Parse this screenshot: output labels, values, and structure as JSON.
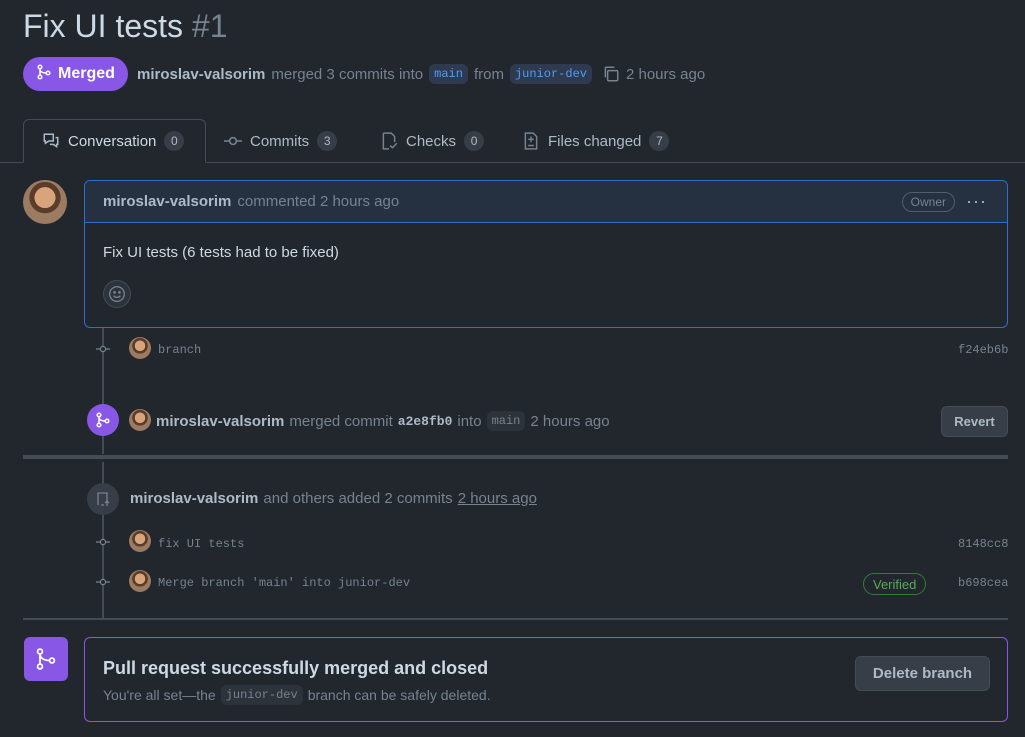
{
  "pr": {
    "title": "Fix UI tests",
    "number": "#1",
    "status": "Merged",
    "author": "miroslav-valsorim",
    "merged_text": "merged 3 commits into",
    "base_branch": "main",
    "from_text": "from",
    "head_branch": "junior-dev",
    "time": "2 hours ago"
  },
  "tabs": [
    {
      "label": "Conversation",
      "count": "0",
      "icon": "comment-discussion-icon"
    },
    {
      "label": "Commits",
      "count": "3",
      "icon": "git-commit-icon"
    },
    {
      "label": "Checks",
      "count": "0",
      "icon": "checklist-icon"
    },
    {
      "label": "Files changed",
      "count": "7",
      "icon": "file-diff-icon"
    }
  ],
  "comment": {
    "author": "miroslav-valsorim",
    "action": "commented 2 hours ago",
    "badge": "Owner",
    "more": "···",
    "body": "Fix UI tests (6 tests had to be fixed)"
  },
  "timeline": {
    "commit1": {
      "message": "branch",
      "sha": "f24eb6b"
    },
    "merge_event": {
      "author": "miroslav-valsorim",
      "text1": "merged commit",
      "sha": "a2e8fb0",
      "text2": "into",
      "branch": "main",
      "time": "2 hours ago",
      "revert_label": "Revert"
    },
    "push_event": {
      "author": "miroslav-valsorim",
      "text": "and others added 2 commits",
      "time": "2 hours ago"
    },
    "commit2": {
      "message": "fix UI tests",
      "sha": "8148cc8"
    },
    "commit3": {
      "message": "Merge branch 'main' into junior-dev",
      "sha": "b698cea",
      "verified": "Verified"
    }
  },
  "merged_box": {
    "title": "Pull request successfully merged and closed",
    "sub1": "You're all set—the",
    "branch": "junior-dev",
    "sub2": "branch can be safely deleted.",
    "delete_label": "Delete branch"
  },
  "colors": {
    "merged": "#8957e5",
    "link": "#539bf5",
    "verified": "#57ab5a",
    "background": "#22272e"
  }
}
